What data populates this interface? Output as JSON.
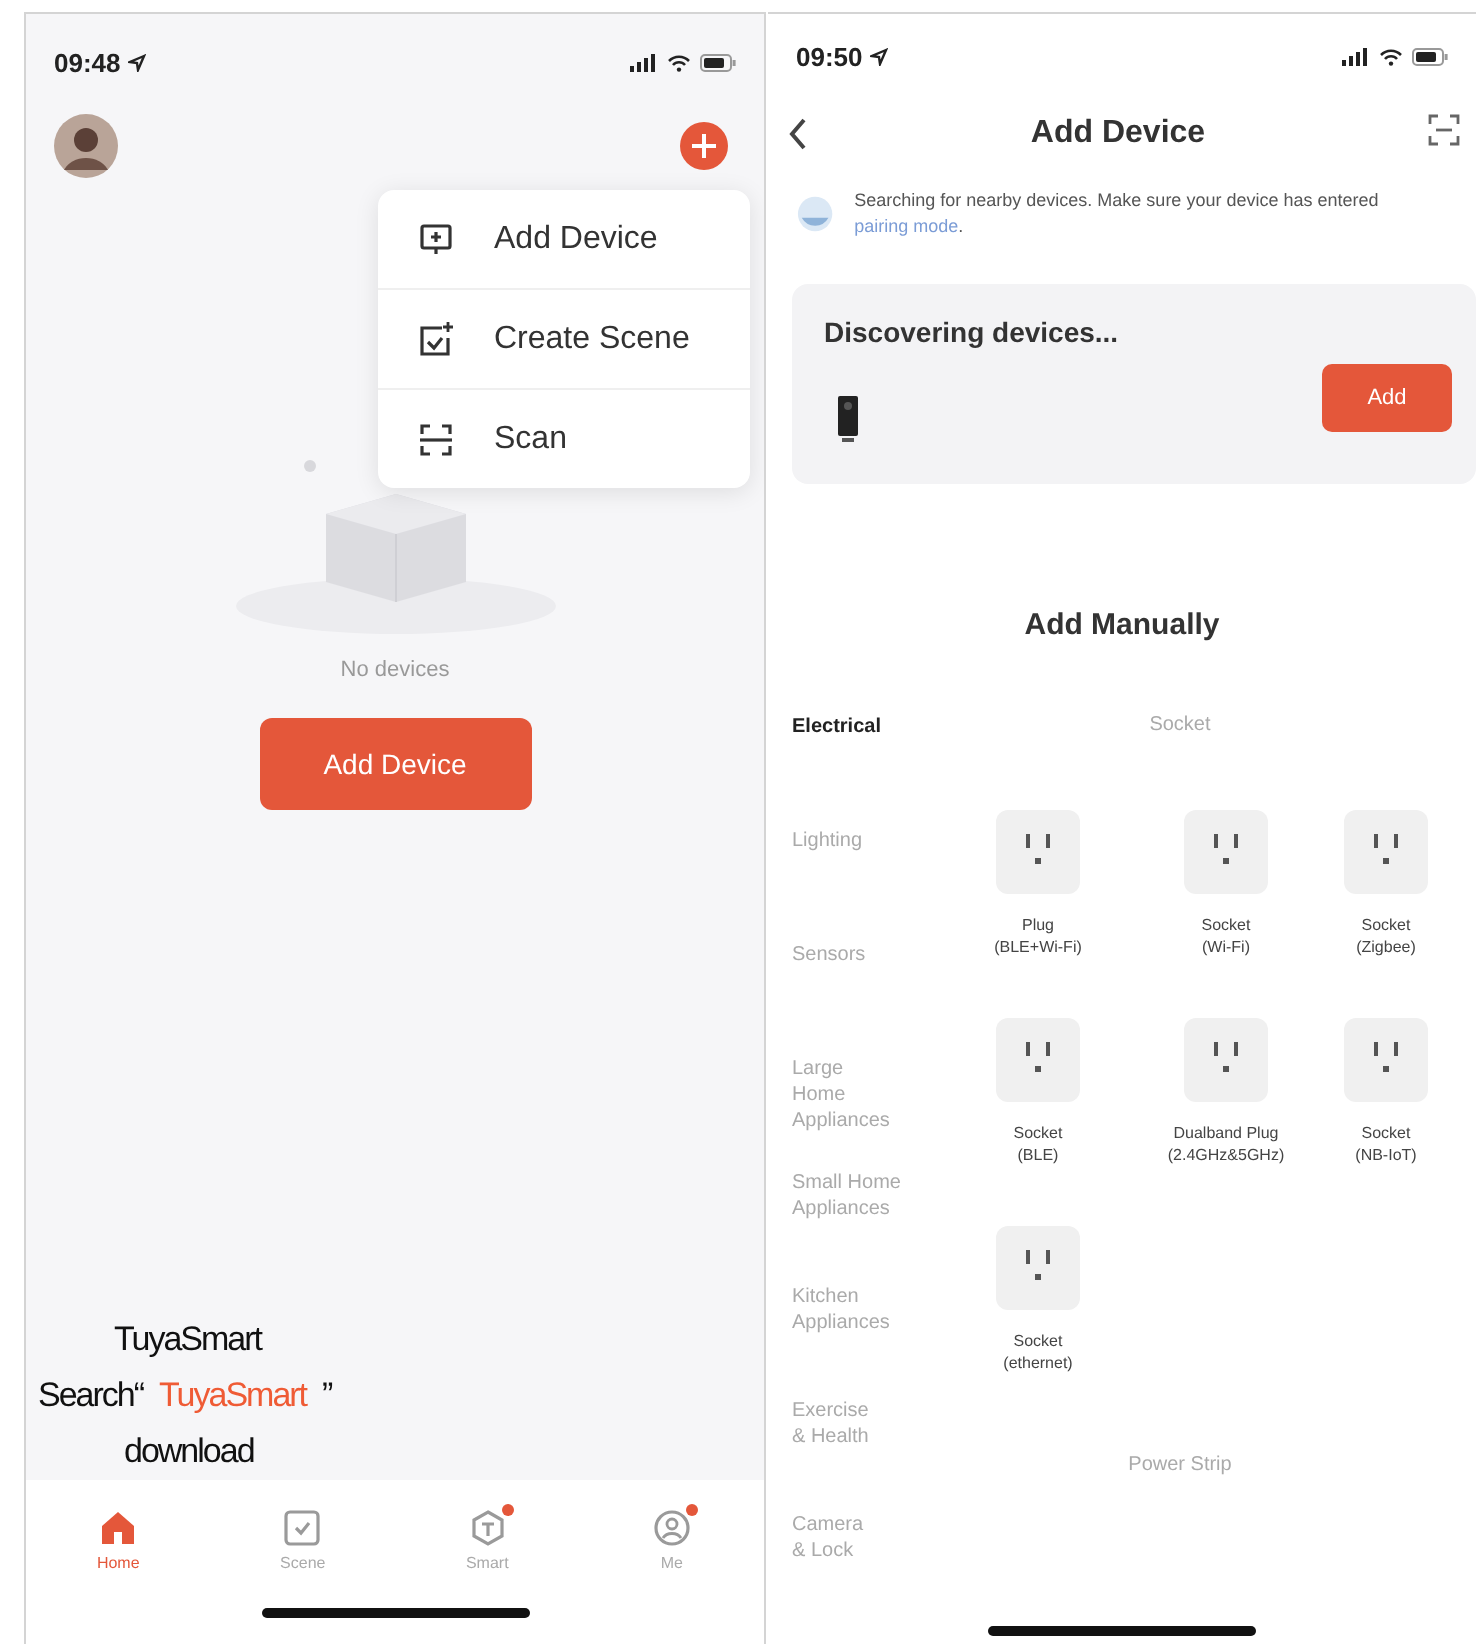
{
  "left_screen": {
    "status_bar": {
      "time": "09:48"
    },
    "menu": {
      "items": [
        {
          "kind": "add-device",
          "label": "Add Device"
        },
        {
          "kind": "create-scene",
          "label": "Create Scene"
        },
        {
          "kind": "scan",
          "label": "Scan"
        }
      ]
    },
    "empty_state": {
      "message": "No devices",
      "button": "Add Device"
    },
    "overlay_text": {
      "line_1": "TuyaSmart",
      "line_2": {
        "before": "Search“",
        "highlight": "TuyaSmart",
        "after": "”"
      },
      "line_3": "download"
    },
    "tab_bar": [
      {
        "kind": "home",
        "label": "Home",
        "selected": true,
        "badge": false
      },
      {
        "kind": "scene",
        "label": "Scene",
        "selected": false,
        "badge": false
      },
      {
        "kind": "smart",
        "label": "Smart",
        "selected": false,
        "badge": true
      },
      {
        "kind": "me",
        "label": "Me",
        "selected": false,
        "badge": true
      }
    ]
  },
  "right_screen": {
    "status_bar": {
      "time": "09:50"
    },
    "nav": {
      "title": "Add Device"
    },
    "notice": {
      "text": "Searching for nearby devices. Make sure your device has entered ",
      "link": "pairing mode",
      "end": "."
    },
    "discovery": {
      "title": "Discovering devices...",
      "button": "Add"
    },
    "manual": {
      "title": "Add Manually",
      "categories": [
        {
          "lines": [
            "Electrical"
          ],
          "selected": true
        },
        {
          "lines": [
            "Lighting"
          ],
          "selected": false
        },
        {
          "lines": [
            "Sensors"
          ],
          "selected": false
        },
        {
          "lines": [
            "Large",
            "Home",
            "Appliances"
          ],
          "selected": false
        },
        {
          "lines": [
            "Small Home",
            "Appliances"
          ],
          "selected": false
        },
        {
          "lines": [
            "Kitchen",
            "Appliances"
          ],
          "selected": false
        },
        {
          "lines": [
            "Exercise",
            "& Health"
          ],
          "selected": false
        },
        {
          "lines": [
            "Camera",
            "& Lock"
          ],
          "selected": false
        }
      ],
      "sections": [
        {
          "title": "Socket",
          "devices": [
            {
              "lines": [
                "Plug",
                "(BLE+Wi-Fi)"
              ]
            },
            {
              "lines": [
                "Socket",
                "(Wi-Fi)"
              ]
            },
            {
              "lines": [
                "Socket",
                "(Zigbee)"
              ]
            },
            {
              "lines": [
                "Socket",
                "(BLE)"
              ]
            },
            {
              "lines": [
                "Dualband Plug",
                "(2.4GHz&5GHz)"
              ]
            },
            {
              "lines": [
                "Socket",
                "(NB-IoT)"
              ]
            },
            {
              "lines": [
                "Socket",
                "(ethernet)"
              ]
            }
          ]
        },
        {
          "title": "Power Strip"
        }
      ]
    }
  }
}
